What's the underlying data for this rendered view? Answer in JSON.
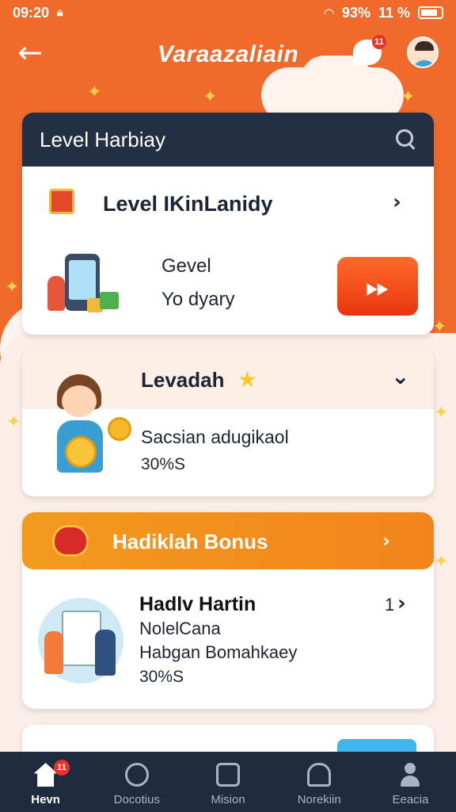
{
  "status_bar": {
    "time": "09:20",
    "battery_text": "93%",
    "signal_text": "11 %"
  },
  "app_bar": {
    "title": "Varaazaliain",
    "chat_badge": "11"
  },
  "card_level": {
    "header": "Level Harbiay",
    "row_label": "Level IKinLanidy",
    "line1": "Gevel",
    "line2": "Yo dyary"
  },
  "card_leaderboard": {
    "header": "Levadah",
    "line1": "Sacsian adugikaol",
    "line2": "30%S"
  },
  "card_bonus": {
    "header": "Hadiklah Bonus",
    "title": "Hadlv Hartin",
    "line1": "NolelCana",
    "line2": "Habgan Bomahkaey",
    "line3": "30%S",
    "count": "1"
  },
  "nav": {
    "items": [
      {
        "label": "Hevn",
        "icon": "home-icon",
        "badge": "11",
        "active": true
      },
      {
        "label": "Docotius",
        "icon": "search-icon",
        "active": false
      },
      {
        "label": "Mision",
        "icon": "mission-icon",
        "active": false
      },
      {
        "label": "Norekiin",
        "icon": "bell-icon",
        "active": false
      },
      {
        "label": "Eeacia",
        "icon": "user-icon",
        "active": false
      }
    ]
  },
  "colors": {
    "brand_orange": "#f06a2b",
    "dark_navy": "#232f44",
    "play_red": "#e8360f",
    "bonus_orange": "#f39a1e"
  }
}
